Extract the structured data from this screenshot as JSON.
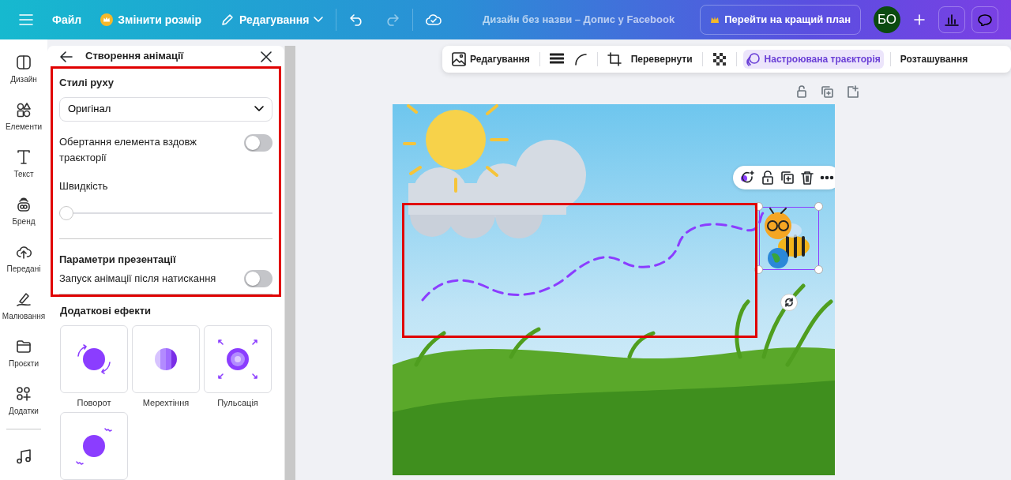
{
  "topbar": {
    "items": [
      {
        "label": "Файл",
        "kind": "plain"
      },
      {
        "label": "Змінити розмір",
        "kind": "crown"
      },
      {
        "label": "Редагування",
        "kind": "pencil"
      }
    ],
    "title": "Дизайн без назви – Допис у Facebook",
    "upgrade": "Перейти на кращий план",
    "avatar": "БО"
  },
  "sidebar": {
    "items": [
      {
        "label": "Дизайн",
        "kind": "layout"
      },
      {
        "label": "Елементи",
        "kind": "shapes"
      },
      {
        "label": "Текст",
        "kind": "text"
      },
      {
        "label": "Бренд",
        "kind": "brand"
      },
      {
        "label": "Передані",
        "kind": "upload"
      },
      {
        "label": "Малювання",
        "kind": "draw"
      },
      {
        "label": "Проєкти",
        "kind": "folder"
      },
      {
        "label": "Додатки",
        "kind": "apps"
      },
      {
        "kind": "music"
      }
    ]
  },
  "panel": {
    "title": "Створення анімації",
    "motion_heading": "Стилі руху",
    "style_value": "Оригінал",
    "rotate_toggle": {
      "label": "Обертання елемента вздовж траєкторії",
      "on": false
    },
    "speed_label": "Швидкість",
    "speed": {
      "level": 0
    },
    "presentation_heading": "Параметри презентації",
    "click_toggle": {
      "label": "Запуск анімації після натискання",
      "on": false
    },
    "effects_heading": "Додаткові ефекти",
    "effects": [
      {
        "label": "Поворот",
        "kind": "rotate"
      },
      {
        "label": "Мерехтіння",
        "kind": "flicker"
      },
      {
        "label": "Пульсація",
        "kind": "pulse"
      },
      {
        "kind": "wobble"
      }
    ]
  },
  "toolbar": {
    "items": [
      {
        "label": "Редагування",
        "kind": "image",
        "selected": false
      },
      {
        "kind": "lines",
        "selected": false
      },
      {
        "kind": "corner",
        "selected": false
      },
      {
        "kind": "crop",
        "selected": false
      },
      {
        "label": "Перевернути",
        "kind": "plain",
        "selected": false
      },
      {
        "kind": "transparency",
        "selected": false
      },
      {
        "label": "Настроювана траєкторія",
        "kind": "path",
        "selected": true
      },
      {
        "label": "Розташування",
        "kind": "plain",
        "selected": false
      }
    ]
  }
}
